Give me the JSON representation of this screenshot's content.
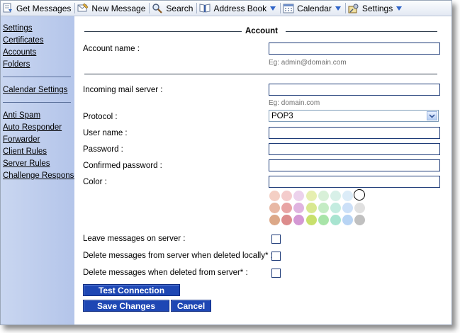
{
  "toolbar": {
    "items": [
      {
        "label": "Get Messages",
        "icon": "get-messages-icon"
      },
      {
        "label": "New Message",
        "icon": "new-message-icon"
      },
      {
        "label": "Search",
        "icon": "search-icon"
      },
      {
        "label": "Address Book",
        "icon": "address-book-icon"
      },
      {
        "label": "Calendar",
        "icon": "calendar-icon"
      },
      {
        "label": "Settings",
        "icon": "settings-icon"
      }
    ]
  },
  "sidebar": {
    "group1": [
      "Settings",
      "Certificates",
      "Accounts",
      "Folders"
    ],
    "group2": [
      "Calendar Settings"
    ],
    "group3": [
      "Anti Spam",
      "Auto Responder",
      "Forwarder",
      "Client Rules",
      "Server Rules",
      "Challenge Response"
    ]
  },
  "form": {
    "section_title": "Account",
    "account_name_label": "Account name :",
    "account_name_hint": "Eg: admin@domain.com",
    "incoming_server_label": "Incoming mail server :",
    "incoming_server_hint": "Eg: domain.com",
    "protocol_label": "Protocol :",
    "protocol_value": "POP3",
    "username_label": "User name :",
    "password_label": "Password :",
    "confirmed_password_label": "Confirmed password :",
    "color_label": "Color :",
    "leave_messages_label": "Leave messages on server :",
    "delete_locally_label": "Delete messages from server when deleted locally* :",
    "delete_from_server_label": "Delete messages when deleted from server* :"
  },
  "colors": [
    [
      "#f4cfc4",
      "#f4cccc",
      "#ecd2ec",
      "#e6efb0",
      "#d8f0d8",
      "#d8f0e8",
      "#dcecf8",
      "#ffffff"
    ],
    [
      "#e8b8a4",
      "#e8a4a4",
      "#e0b4e0",
      "#d8e890",
      "#c4ecc4",
      "#c4ece0",
      "#cce0f8",
      "#e0e0e0"
    ],
    [
      "#dca888",
      "#dc8c8c",
      "#d498d4",
      "#c8e06c",
      "#a8e4a8",
      "#a8e4d0",
      "#b8d4f4",
      "#c0c0c0"
    ]
  ],
  "buttons": {
    "test_connection": "Test Connection",
    "save_changes": "Save Changes",
    "cancel": "Cancel"
  }
}
